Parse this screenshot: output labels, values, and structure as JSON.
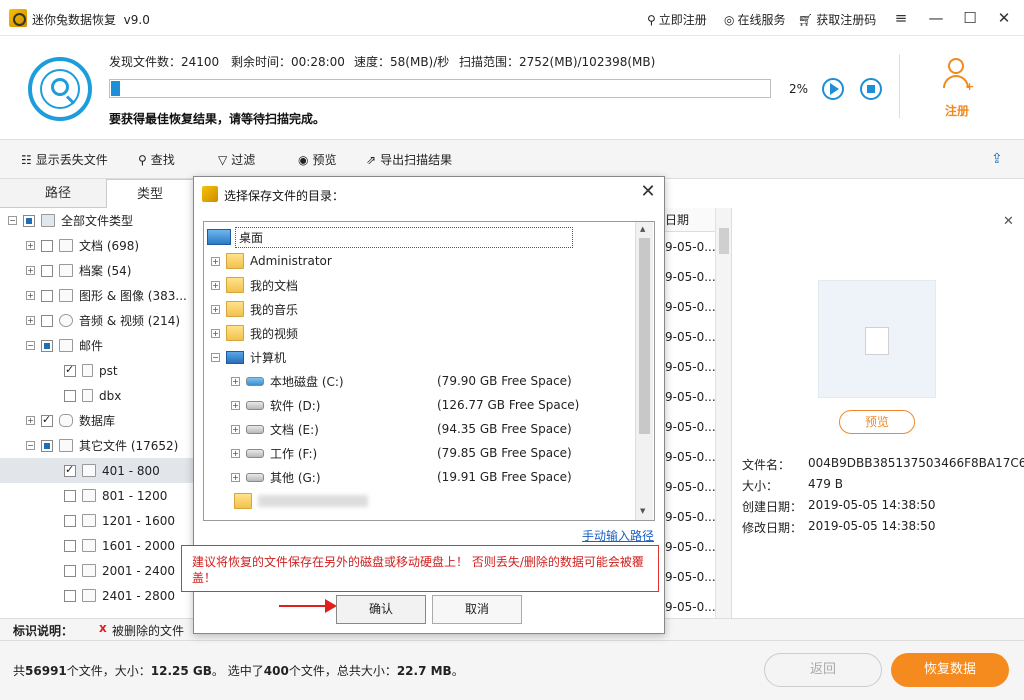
{
  "titlebar": {
    "title": "迷你兔数据恢复",
    "version": "v9.0",
    "register_link": "立即注册",
    "online_service": "在线服务",
    "get_code": "获取注册码"
  },
  "scan": {
    "found_label": "发现文件数：",
    "found_value": "24100",
    "remain_label": "剩余时间：",
    "remain_value": "00:28:00",
    "speed_label": "速度：",
    "speed_value": "58(MB)/秒",
    "range_label": "扫描范围：",
    "range_value": "2752(MB)/102398(MB)",
    "progress_percent": 2,
    "progress_text": "2%",
    "notice": "要获得最佳恢复结果，请等待扫描完成。",
    "register_button": "注册"
  },
  "toolbar": {
    "show_lost": "显示丢失文件",
    "find": "查找",
    "filter": "过滤",
    "preview": "预览",
    "export": "导出扫描结果"
  },
  "tabs": {
    "path": "路径",
    "type": "类型"
  },
  "tree": {
    "root": "全部文件类型",
    "items": [
      {
        "label": "文档 (698)"
      },
      {
        "label": "档案 (54)"
      },
      {
        "label": "图形 & 图像 (383..."
      },
      {
        "label": "音频 & 视频 (214)"
      },
      {
        "label": "邮件"
      },
      {
        "label": "pst"
      },
      {
        "label": "dbx"
      },
      {
        "label": "数据库"
      },
      {
        "label": "其它文件 (17652)"
      },
      {
        "label": "401 - 800"
      },
      {
        "label": "801 - 1200"
      },
      {
        "label": "1201 - 1600"
      },
      {
        "label": "1601 - 2000"
      },
      {
        "label": "2001 - 2400"
      },
      {
        "label": "2401 - 2800"
      }
    ]
  },
  "midlist": {
    "header": "日期",
    "rows": [
      "9-05-0...",
      "9-05-0...",
      "9-05-0...",
      "9-05-0...",
      "9-05-0...",
      "9-05-0...",
      "9-05-0...",
      "9-05-0...",
      "9-05-0...",
      "9-05-0...",
      "9-05-0...",
      "9-05-0...",
      "9-05-0..."
    ]
  },
  "preview": {
    "button": "预览",
    "name_label": "文件名：",
    "name_value": "004B9DBB385137503466F8BA17C6",
    "size_label": "大小：",
    "size_value": "479 B",
    "created_label": "创建日期：",
    "created_value": "2019-05-05 14:38:50",
    "modified_label": "修改日期：",
    "modified_value": "2019-05-05 14:38:50"
  },
  "legend": {
    "title": "标识说明：",
    "mark": "x",
    "deleted": "被删除的文件"
  },
  "status": {
    "total_prefix": "共",
    "total_count": "56991",
    "total_mid": "个文件，大小：",
    "total_size": "12.25 GB",
    "sel_prefix": "。 选中了",
    "sel_count": "400",
    "sel_mid": "个文件，总共大小：",
    "sel_size": "22.7 MB",
    "sel_suffix": "。",
    "back": "返回",
    "recover": "恢复数据"
  },
  "dialog": {
    "title": "选择保存文件的目录：",
    "desktop": "桌面",
    "administrator": "Administrator",
    "my_docs": "我的文档",
    "my_music": "我的音乐",
    "my_videos": "我的视频",
    "computer": "计算机",
    "drives": [
      {
        "name": "本地磁盘 (C:)",
        "free": "(79.90 GB Free Space)"
      },
      {
        "name": "软件 (D:)",
        "free": "(126.77 GB Free Space)"
      },
      {
        "name": "文档 (E:)",
        "free": "(94.35 GB Free Space)"
      },
      {
        "name": "工作 (F:)",
        "free": "(79.85 GB Free Space)"
      },
      {
        "name": "其他 (G:)",
        "free": "(19.91 GB Free Space)"
      }
    ],
    "manual_path": "手动输入路径",
    "warning": "建议将恢复的文件保存在另外的磁盘或移动硬盘上！ 否则丢失/删除的数据可能会被覆盖！",
    "ok": "确认",
    "cancel": "取消"
  }
}
